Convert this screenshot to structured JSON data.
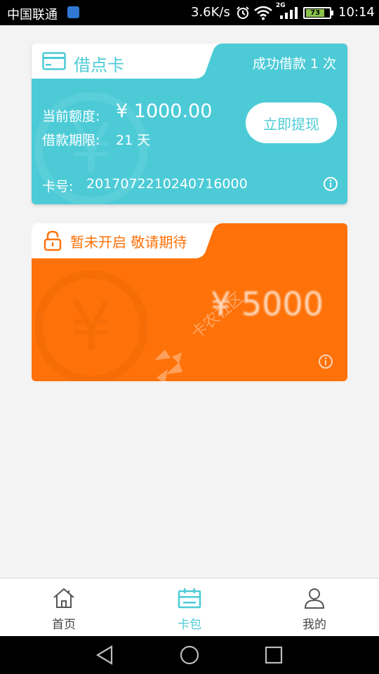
{
  "status_bar": {
    "carrier": "中国联通",
    "speed": "3.6K/s",
    "signal_label": "2G",
    "battery": "73",
    "time": "10:14"
  },
  "loan_card": {
    "title": "借点卡",
    "loan_count": "成功借款 1 次",
    "quota_label": "当前额度:",
    "quota_value": "¥ 1000.00",
    "term_label": "借款期限:",
    "term_value": "21 天",
    "withdraw_label": "立即提现",
    "card_no_label": "卡号:",
    "card_no_value": "20170722102407160​00"
  },
  "locked_card": {
    "title": "暂未开启 敬请期待",
    "amount": "¥ 5000",
    "watermark_text": "卡农社区"
  },
  "bottom_nav": {
    "items": [
      {
        "label": "首页",
        "icon": "home-icon"
      },
      {
        "label": "卡包",
        "icon": "card-wallet-icon",
        "active": true
      },
      {
        "label": "我的",
        "icon": "person-icon"
      }
    ]
  },
  "colors": {
    "accent": "#4ccbd7",
    "orange": "#fe7209",
    "background": "#f3f3f3"
  }
}
